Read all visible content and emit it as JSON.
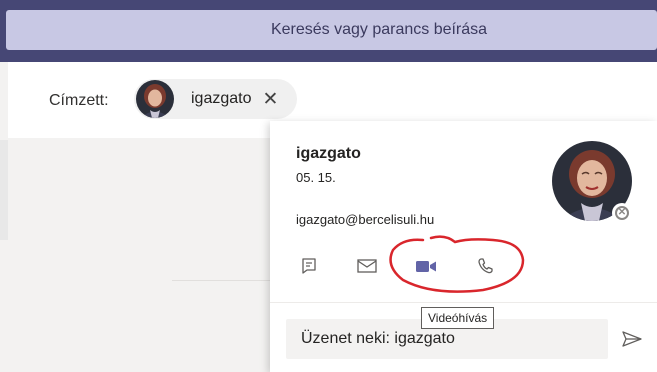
{
  "search": {
    "placeholder": "Keresés vagy parancs beírása"
  },
  "compose": {
    "to_label": "Címzett:",
    "recipient_chip": {
      "name": "igazgato",
      "remove_icon": "close-icon"
    }
  },
  "profile_card": {
    "name": "igazgato",
    "date": "05. 15.",
    "email": "igazgato@bercelisuli.hu",
    "presence": "offline",
    "actions": [
      {
        "name": "chat",
        "icon": "chat-icon"
      },
      {
        "name": "email",
        "icon": "mail-icon"
      },
      {
        "name": "video-call",
        "icon": "video-camera-icon",
        "tooltip": "Videóhívás"
      },
      {
        "name": "audio-call",
        "icon": "phone-icon"
      }
    ],
    "message": {
      "placeholder": "Üzenet neki: igazgato",
      "send_icon": "send-icon"
    }
  },
  "colors": {
    "header": "#464775",
    "search_bg": "#c8c8e4",
    "accent": "#6264a7",
    "annotation": "#d9262c"
  }
}
